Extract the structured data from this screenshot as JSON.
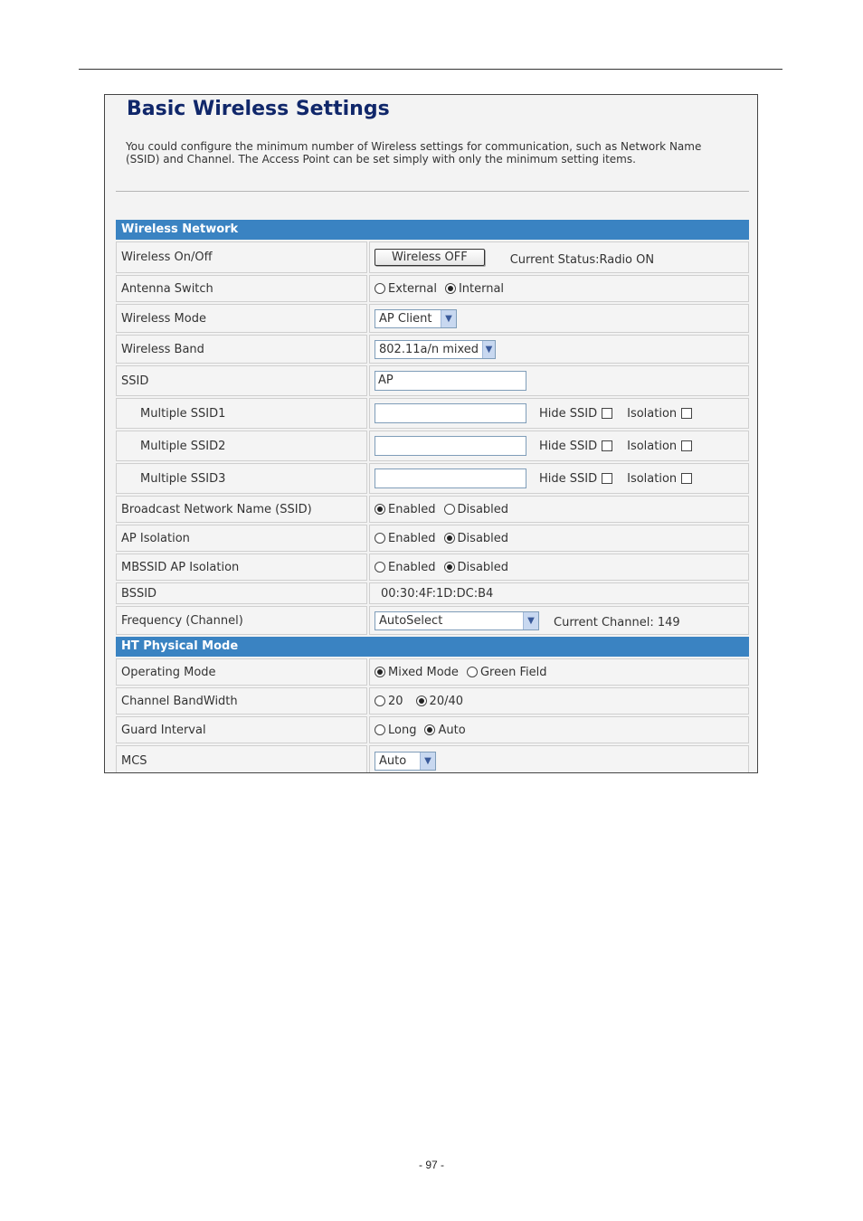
{
  "page": {
    "number": "- 97 -"
  },
  "header": {
    "title": "Basic Wireless Settings",
    "description": "You could configure the minimum number of Wireless settings for communication, such as Network Name (SSID) and Channel. The Access Point can be set simply with only the minimum setting items."
  },
  "wireless_network": {
    "section_title": "Wireless Network",
    "onoff": {
      "label": "Wireless On/Off",
      "button": "Wireless OFF",
      "status": "Current Status:Radio ON"
    },
    "antenna": {
      "label": "Antenna Switch",
      "options": [
        "External",
        "Internal"
      ],
      "selected": "Internal"
    },
    "mode": {
      "label": "Wireless Mode",
      "value": "AP Client"
    },
    "band": {
      "label": "Wireless Band",
      "value": "802.11a/n mixed"
    },
    "ssid": {
      "label": "SSID",
      "value": "AP"
    },
    "multi_ssid": [
      {
        "label": "Multiple SSID1",
        "value": "",
        "hide_label": "Hide SSID",
        "isolation_label": "Isolation"
      },
      {
        "label": "Multiple SSID2",
        "value": "",
        "hide_label": "Hide SSID",
        "isolation_label": "Isolation"
      },
      {
        "label": "Multiple SSID3",
        "value": "",
        "hide_label": "Hide SSID",
        "isolation_label": "Isolation"
      }
    ],
    "broadcast": {
      "label": "Broadcast Network Name (SSID)",
      "options": [
        "Enabled",
        "Disabled"
      ],
      "selected": "Enabled"
    },
    "ap_isolation": {
      "label": "AP Isolation",
      "options": [
        "Enabled",
        "Disabled"
      ],
      "selected": "Disabled"
    },
    "mbssid_isolation": {
      "label": "MBSSID AP Isolation",
      "options": [
        "Enabled",
        "Disabled"
      ],
      "selected": "Disabled"
    },
    "bssid": {
      "label": "BSSID",
      "value": "00:30:4F:1D:DC:B4"
    },
    "frequency": {
      "label": "Frequency (Channel)",
      "value": "AutoSelect",
      "current": "Current Channel: 149"
    }
  },
  "ht_physical_mode": {
    "section_title": "HT Physical Mode",
    "operating": {
      "label": "Operating Mode",
      "options": [
        "Mixed Mode",
        "Green Field"
      ],
      "selected": "Mixed Mode"
    },
    "bandwidth": {
      "label": "Channel BandWidth",
      "options": [
        "20",
        "20/40"
      ],
      "selected": "20/40"
    },
    "guard": {
      "label": "Guard Interval",
      "options": [
        "Long",
        "Auto"
      ],
      "selected": "Auto"
    },
    "mcs": {
      "label": "MCS",
      "value": "Auto"
    }
  },
  "icons": {
    "radio_on": "radio-selected-icon",
    "radio_off": "radio-unselected-icon",
    "dropdown": "chevron-down-icon"
  }
}
